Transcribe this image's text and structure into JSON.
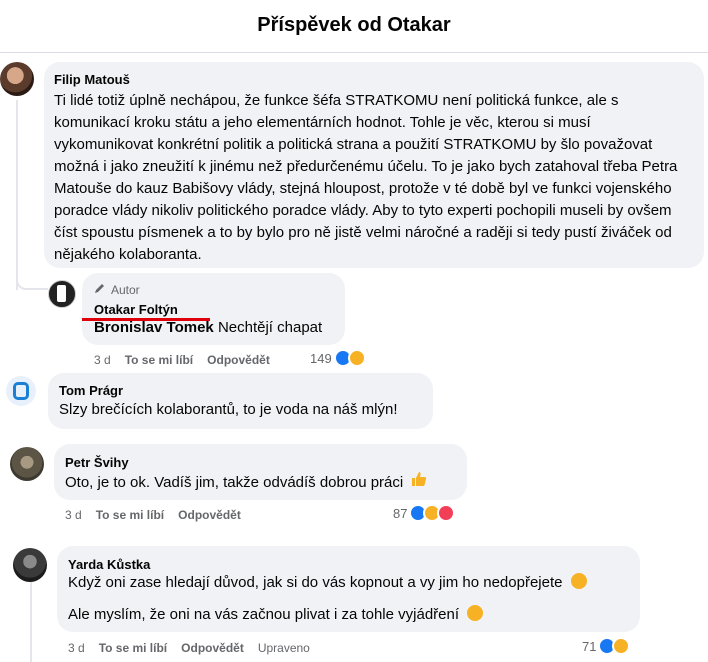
{
  "header": {
    "title": "Příspěvek od Otakar"
  },
  "comments": [
    {
      "author": "Filip Matouš",
      "text": "Ti lidé totiž úplně nechápou, že funkce šéfa STRATKOMU není politická funkce, ale s komunikací kroku státu a jeho elementárních hodnot. Tohle je věc, kterou si musí vykomunikovat konkrétní politik a politická strana a použití STRATKOMU by šlo považovat možná i jako zneužití k jinému než předurčenému účelu. To je jako bych zatahoval třeba Petra Matouše do kauz Babišovy vlády, stejná hloupost, protože v té době byl ve funkci vojenského poradce vlády nikoliv politického poradce vlády. Aby to tyto experti pochopili museli by ovšem číst spoustu písmenek a to by bylo pro ně jistě velmi náročné a raději si tedy pustí živáček od nějakého kolaboranta."
    },
    {
      "badge": "Autor",
      "author": "Otakar Foltýn",
      "mention": "Bronislav Tomek",
      "text": "Nechtějí chapat",
      "time": "3 d",
      "like": "To se mi líbí",
      "reply": "Odpovědět",
      "count": "149"
    },
    {
      "author": "Tom Prágr",
      "text": "Slzy brečících kolaborantů, to je voda na náš mlýn!"
    },
    {
      "author": "Petr Švihy",
      "text": "Oto, je to ok. Vadíš jim, takže odvádíš dobrou práci",
      "time": "3 d",
      "like": "To se mi líbí",
      "reply": "Odpovědět",
      "count": "87"
    },
    {
      "author": "Yarda Kůstka",
      "text1": "Když oni zase hledají důvod, jak si do vás kopnout a vy jim ho nedopřejete",
      "text2": "Ale myslím, že oni na vás začnou plivat i za tohle vyjádření",
      "time": "3 d",
      "like": "To se mi líbí",
      "reply": "Odpovědět",
      "edited": "Upraveno",
      "count": "71"
    }
  ],
  "colors": {
    "like": "#1877f2",
    "haha": "#f7b125",
    "love": "#f33e58",
    "bubble": "#f0f2f5",
    "underline": "#e0000b"
  }
}
